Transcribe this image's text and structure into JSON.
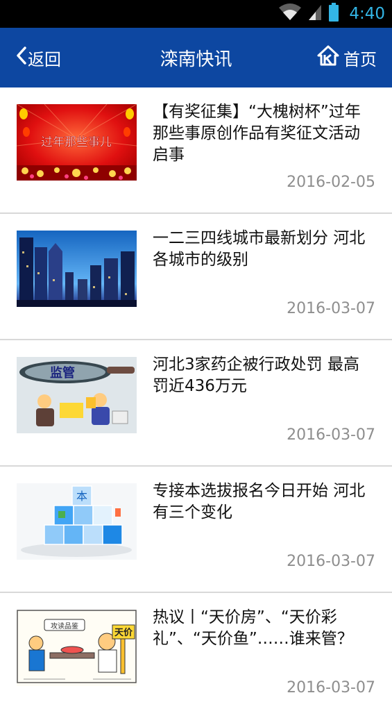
{
  "status_bar": {
    "time": "4:40",
    "time_color": "#33b5e5"
  },
  "header": {
    "back_label": "返回",
    "title": "滦南快讯",
    "home_label": "首页",
    "background": "#0d47a1"
  },
  "articles": [
    {
      "title": "【有奖征集】“大槐树杯”过年那些事原创作品有奖征文活动启事",
      "date": "2016-02-05",
      "thumb_text": "过年那些事儿"
    },
    {
      "title": "一二三四线城市最新划分 河北各城市的级别",
      "date": "2016-03-07"
    },
    {
      "title": "河北3家药企被行政处罚 最高罚近436万元",
      "date": "2016-03-07",
      "thumb_text": "监管"
    },
    {
      "title": "专接本选拔报名今日开始 河北有三个变化",
      "date": "2016-03-07",
      "thumb_text": "本"
    },
    {
      "title": "热议丨“天价房”、“天价彩礼”、“天价鱼”……谁来管？",
      "date": "2016-03-07",
      "thumb_text": "天价",
      "thumb_text2": "攻读品鉴"
    }
  ]
}
